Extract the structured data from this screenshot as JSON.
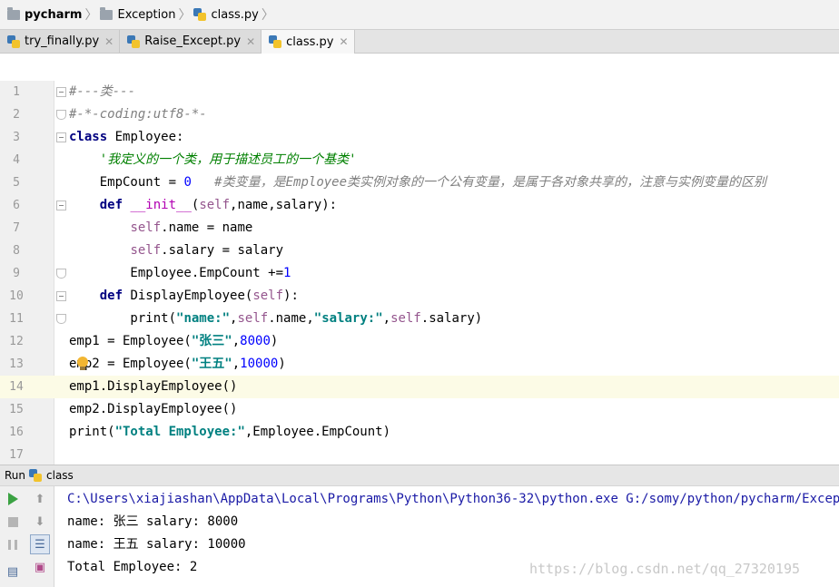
{
  "breadcrumb": [
    "pycharm",
    "Exception",
    "class.py"
  ],
  "tabs": [
    {
      "label": "try_finally.py",
      "active": false
    },
    {
      "label": "Raise_Except.py",
      "active": false
    },
    {
      "label": "class.py",
      "active": true
    }
  ],
  "editor": {
    "current_line": 14,
    "lines": [
      {
        "n": "1",
        "text": "#---类---"
      },
      {
        "n": "2",
        "text": "#-*-coding:utf8-*-"
      },
      {
        "n": "3",
        "text": "class Employee:"
      },
      {
        "n": "4",
        "text": "    '我定义的一个类，用于描述员工的一个基类'"
      },
      {
        "n": "5",
        "text": "    EmpCount = 0   #类变量，是Employee类实例对象的一个公有变量，是属于各对象共享的，注意与实例变量的区别"
      },
      {
        "n": "6",
        "text": "    def __init__(self,name,salary):"
      },
      {
        "n": "7",
        "text": "        self.name = name"
      },
      {
        "n": "8",
        "text": "        self.salary = salary"
      },
      {
        "n": "9",
        "text": "        Employee.EmpCount +=1"
      },
      {
        "n": "10",
        "text": "    def DisplayEmployee(self):"
      },
      {
        "n": "11",
        "text": "        print(\"name:\",self.name,\"salary:\",self.salary)"
      },
      {
        "n": "12",
        "text": "emp1 = Employee(\"张三\",8000)"
      },
      {
        "n": "13",
        "text": "emp2 = Employee(\"王五\",10000)"
      },
      {
        "n": "14",
        "text": "emp1.DisplayEmployee()"
      },
      {
        "n": "15",
        "text": "emp2.DisplayEmployee()"
      },
      {
        "n": "16",
        "text": "print(\"Total Employee:\",Employee.EmpCount)"
      },
      {
        "n": "17",
        "text": ""
      }
    ]
  },
  "run": {
    "header_label": "Run",
    "config_name": "class",
    "console_lines": [
      "C:\\Users\\xiajiashan\\AppData\\Local\\Programs\\Python\\Python36-32\\python.exe G:/somy/python/pycharm/Exception/c",
      "name: 张三 salary: 8000",
      "name: 王五 salary: 10000",
      "Total Employee: 2"
    ]
  },
  "watermark": "https://blog.csdn.net/qq_27320195",
  "colors": {
    "keyword": "#000080",
    "string": "#008080",
    "number": "#0000ff",
    "self": "#94558d",
    "comment": "#808080",
    "run_green": "#3ba243"
  }
}
